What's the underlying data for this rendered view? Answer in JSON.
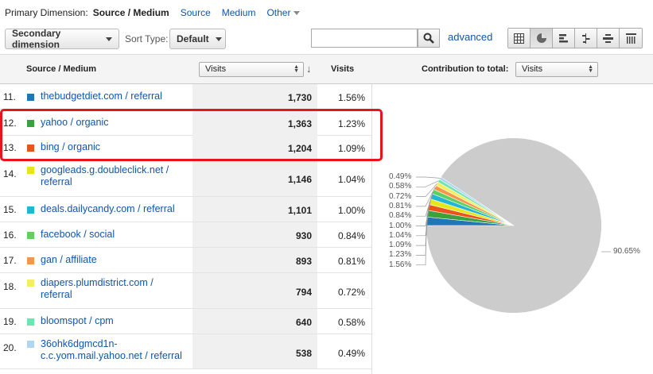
{
  "primary": {
    "label": "Primary Dimension:",
    "selected": "Source / Medium",
    "links": [
      "Source",
      "Medium"
    ],
    "other": "Other"
  },
  "toolbar": {
    "secondary_dimension": "Secondary dimension",
    "sort_type_label": "Sort Type:",
    "sort_type_value": "Default",
    "search_placeholder": "",
    "advanced": "advanced"
  },
  "header": {
    "source_medium": "Source / Medium",
    "visits_select": "Visits",
    "visits_col": "Visits",
    "contribution": "Contribution to total:",
    "contribution_select": "Visits"
  },
  "rows": [
    {
      "num": "11.",
      "name1": "thebudgetdiet.com / referral",
      "name2": "",
      "visits": "1,730",
      "pct": "1.56%",
      "color": "#1f77b4",
      "pct_value": 1.56
    },
    {
      "num": "12.",
      "name1": "yahoo / organic",
      "name2": "",
      "visits": "1,363",
      "pct": "1.23%",
      "color": "#3ca03c",
      "pct_value": 1.23
    },
    {
      "num": "13.",
      "name1": "bing / organic",
      "name2": "",
      "visits": "1,204",
      "pct": "1.09%",
      "color": "#e8541c",
      "pct_value": 1.09
    },
    {
      "num": "14.",
      "name1": "googleads.g.doubleclick.net /",
      "name2": "referral",
      "visits": "1,146",
      "pct": "1.04%",
      "color": "#e6e61a",
      "pct_value": 1.04
    },
    {
      "num": "15.",
      "name1": "deals.dailycandy.com / referral",
      "name2": "",
      "visits": "1,101",
      "pct": "1.00%",
      "color": "#22b5d4",
      "pct_value": 1.0
    },
    {
      "num": "16.",
      "name1": "facebook / social",
      "name2": "",
      "visits": "930",
      "pct": "0.84%",
      "color": "#5fcf5f",
      "pct_value": 0.84
    },
    {
      "num": "17.",
      "name1": "gan / affiliate",
      "name2": "",
      "visits": "893",
      "pct": "0.81%",
      "color": "#f5964a",
      "pct_value": 0.81
    },
    {
      "num": "18.",
      "name1": "diapers.plumdistrict.com /",
      "name2": "referral",
      "visits": "794",
      "pct": "0.72%",
      "color": "#f4ef5e",
      "pct_value": 0.72
    },
    {
      "num": "19.",
      "name1": "bloomspot / cpm",
      "name2": "",
      "visits": "640",
      "pct": "0.58%",
      "color": "#6fe3b0",
      "pct_value": 0.58
    },
    {
      "num": "20.",
      "name1": "36ohk6dgmcd1n-",
      "name2": "c.c.yom.mail.yahoo.net / referral",
      "visits": "538",
      "pct": "0.49%",
      "color": "#aed6f1",
      "pct_value": 0.49
    }
  ],
  "pie": {
    "labels_left": [
      "0.49%",
      "0.58%",
      "0.72%",
      "0.81%",
      "0.84%",
      "1.00%",
      "1.04%",
      "1.09%",
      "1.23%",
      "1.56%"
    ],
    "rest_label": "90.65%",
    "rest_value": 90.65,
    "rest_color": "#cccccc"
  }
}
